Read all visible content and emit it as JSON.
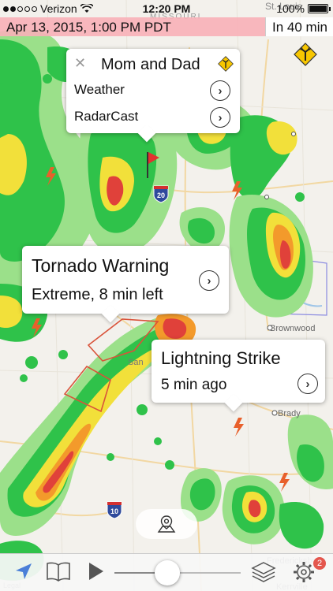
{
  "status_bar": {
    "carrier": "Verizon",
    "time": "12:20 PM",
    "battery": "100%"
  },
  "time_strip": {
    "date": "Apr 13, 2015, 1:00 PM PDT",
    "relative": "In 40 min"
  },
  "map": {
    "labels": {
      "missouri": "MISSOURI",
      "st_louis": "St. Louis",
      "brownwood": "Brownwood",
      "brady": "Brady",
      "fredericksburg": "Fredericksburg",
      "kerrville": "Kerrville",
      "san": "San"
    },
    "highways": {
      "i20": "20",
      "i10": "10"
    },
    "legal": "Legal"
  },
  "location_card": {
    "title": "Mom and Dad",
    "close": "✕",
    "rows": [
      "Weather",
      "RadarCast"
    ]
  },
  "tornado_card": {
    "title": "Tornado Warning",
    "subtitle": "Extreme, 8 min left"
  },
  "lightning_card": {
    "title": "Lightning Strike",
    "subtitle": "5 min ago"
  },
  "toolbar": {
    "badge": "2",
    "slider_progress": 0.42
  },
  "colors": {
    "radar_light": "#9be08a",
    "radar_green": "#2fc24a",
    "radar_yellow": "#f2e03a",
    "radar_orange": "#f39a2b",
    "radar_red": "#e0413a",
    "warning": "#d9533a",
    "sign_yellow": "#f7c600",
    "badge": "#e4564d",
    "time_strip": "#f8b0b8"
  }
}
